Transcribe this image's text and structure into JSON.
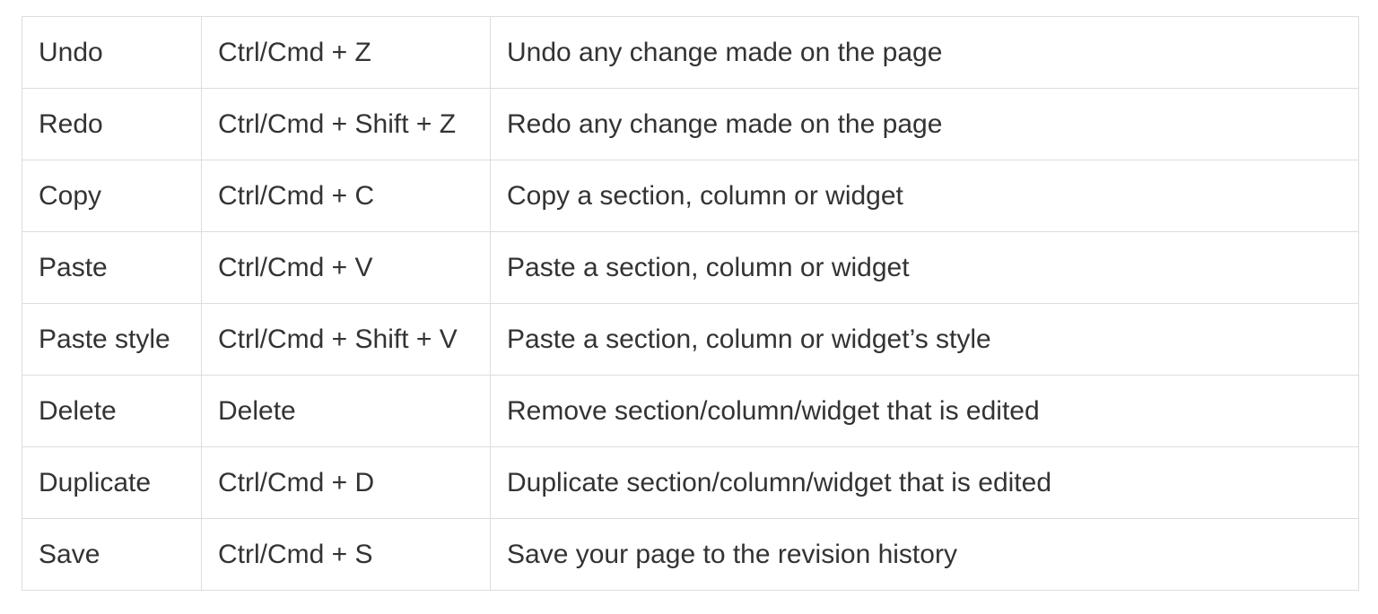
{
  "shortcuts": {
    "rows": [
      {
        "action": "Undo",
        "shortcut": "Ctrl/Cmd + Z",
        "description": "Undo any change made on the page"
      },
      {
        "action": "Redo",
        "shortcut": "Ctrl/Cmd + Shift + Z",
        "description": "Redo any change made on the page"
      },
      {
        "action": "Copy",
        "shortcut": "Ctrl/Cmd + C",
        "description": "Copy a section, column or widget"
      },
      {
        "action": "Paste",
        "shortcut": "Ctrl/Cmd + V",
        "description": "Paste a section, column or widget"
      },
      {
        "action": "Paste style",
        "shortcut": "Ctrl/Cmd + Shift + V",
        "description": "Paste a section, column or widget’s style"
      },
      {
        "action": "Delete",
        "shortcut": "Delete",
        "description": "Remove section/column/widget that is edited"
      },
      {
        "action": "Duplicate",
        "shortcut": "Ctrl/Cmd + D",
        "description": "Duplicate section/column/widget that is edited"
      },
      {
        "action": "Save",
        "shortcut": "Ctrl/Cmd + S",
        "description": "Save your page to the revision history"
      }
    ]
  }
}
